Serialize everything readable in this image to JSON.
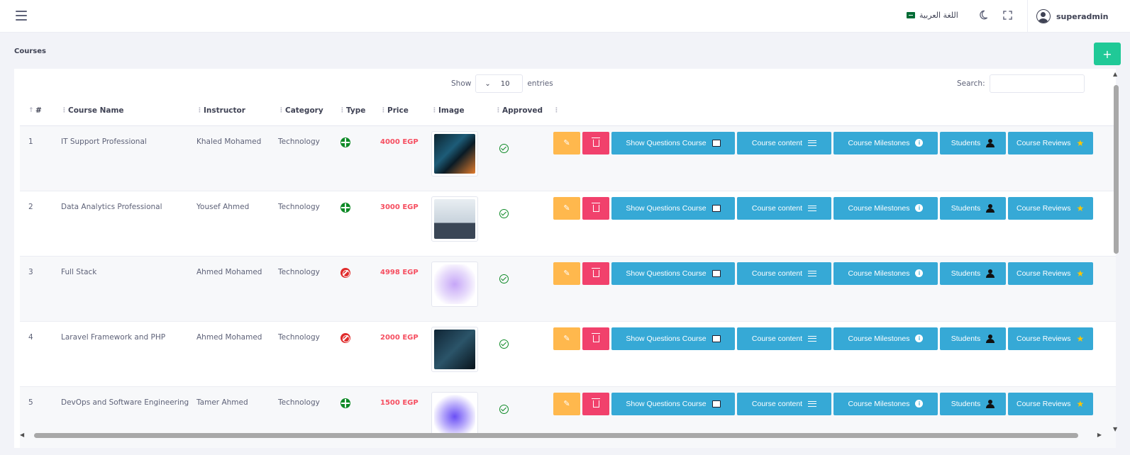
{
  "topbar": {
    "menu_icon": "hamburger-icon",
    "language_label": "اللغة العربية",
    "username": "superadmin"
  },
  "page": {
    "title": "Courses",
    "add_button": "+"
  },
  "controls": {
    "show_label": "Show",
    "entries_value": "10",
    "entries_label": "entries",
    "search_label": "Search:"
  },
  "table": {
    "headers": [
      "#",
      "Course Name",
      "Instructor",
      "Category",
      "Type",
      "Price",
      "Image",
      "Approved"
    ],
    "rows": [
      {
        "num": "1",
        "name": "IT Support Professional",
        "instructor": "Khaled Mohamed",
        "category": "Technology",
        "type": "online",
        "price": "4000 EGP",
        "approved": true
      },
      {
        "num": "2",
        "name": "Data Analytics Professional",
        "instructor": "Yousef Ahmed",
        "category": "Technology",
        "type": "online",
        "price": "3000 EGP",
        "approved": true
      },
      {
        "num": "3",
        "name": "Full Stack",
        "instructor": "Ahmed Mohamed",
        "category": "Technology",
        "type": "offline",
        "price": "4998 EGP",
        "approved": true
      },
      {
        "num": "4",
        "name": "Laravel Framework and PHP",
        "instructor": "Ahmed Mohamed",
        "category": "Technology",
        "type": "offline",
        "price": "2000 EGP",
        "approved": true
      },
      {
        "num": "5",
        "name": "DevOps and Software Engineering",
        "instructor": "Tamer Ahmed",
        "category": "Technology",
        "type": "online",
        "price": "1500 EGP",
        "approved": true
      }
    ],
    "actions": {
      "show_questions": "Show Questions Course",
      "course_content": "Course content",
      "course_milestones": "Course Milestones",
      "students": "Students",
      "course_reviews": "Course Reviews"
    }
  },
  "colors": {
    "add_button": "#20c997",
    "edit_button": "#ffb84d",
    "delete_button": "#f1416c",
    "info_button": "#36a9d6",
    "price": "#f64e60",
    "approved": "#0f8a27"
  }
}
